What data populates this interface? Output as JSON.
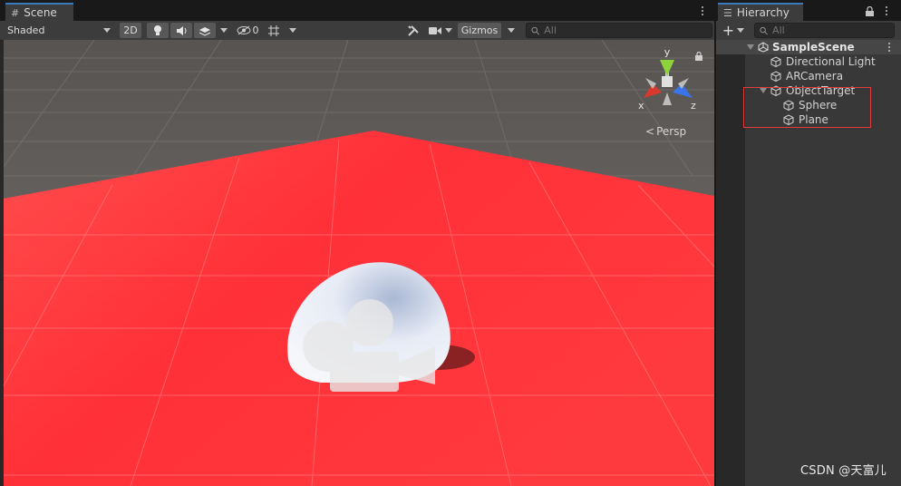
{
  "scene": {
    "tab_label": "Scene",
    "shading_mode": "Shaded",
    "mode_2d": "2D",
    "hidden_count": "0",
    "gizmos_label": "Gizmos",
    "search_placeholder": "All",
    "axis_x": "x",
    "axis_y": "y",
    "axis_z": "z",
    "projection_label": "Persp"
  },
  "hierarchy": {
    "tab_label": "Hierarchy",
    "search_placeholder": "All",
    "add_label": "+",
    "root": "SampleScene",
    "items": [
      "Directional Light",
      "ARCamera",
      "ObjectTarget",
      "Sphere",
      "Plane"
    ]
  },
  "watermark": "CSDN @天富儿",
  "colors": {
    "plane": "#ff3b3f",
    "sky": "#6b6866",
    "panel_bg": "#282828",
    "toolbar_bg": "#3c3c3c",
    "highlight_box": "#e03c3c",
    "axis_x": "#d8392b",
    "axis_y": "#8ed33c",
    "axis_z": "#3a74e8"
  }
}
